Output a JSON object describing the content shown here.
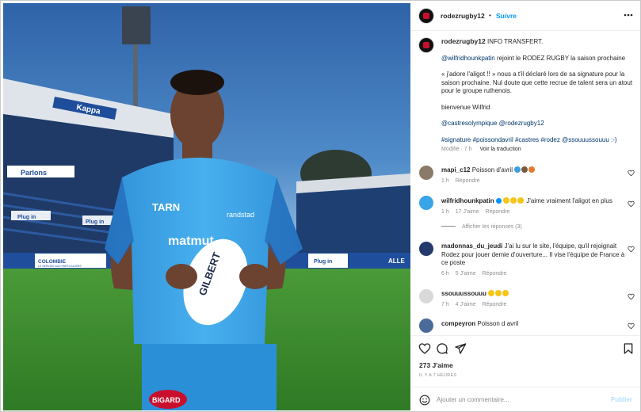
{
  "post": {
    "username": "rodezrugby12",
    "follow_label": "Suivre",
    "dot": "•"
  },
  "photo": {
    "banner_texts": [
      "Kappa",
      "Parlons",
      "Plug in",
      "Plug in",
      "COLOMBIE",
      "LE SERVICE AUX PARTICULIERS",
      "Plug in",
      "randstad",
      "TARN",
      "GILBERT",
      "BIGARD",
      "matmut",
      "ALLE"
    ],
    "colors": {
      "sky": "#3d6fb0",
      "jersey": "#3aa4e8",
      "grass": "#3d8a2f"
    }
  },
  "caption": {
    "author": "rodezrugby12",
    "headline": "INFO TRANSFERT.",
    "mention_player": "@wilfridhounkpatin",
    "line1_rest": " rejoint le RODEZ RUGBY la saison prochaine",
    "quote": "« j'adore l'aligot !! » nous a t'il déclaré lors de sa signature pour la saison prochaine. Nul doute que cette recrue de talent sera un atout pour le groupe ruthenois.",
    "welcome": "bienvenue Wilfrid",
    "mentions": "@castresolympique @rodezrugby12",
    "hashtags": "#signature #poissondavril #castres #rodez @ssouuussouuu :-)",
    "modified": "Modifié · 7 h",
    "translate": "Voir la traduction"
  },
  "comments": [
    {
      "user": "mapi_c12",
      "text": "Poisson d'avril",
      "time": "1 h",
      "likes": "",
      "reply": "Répondre"
    },
    {
      "user": "wilfridhounkpatin",
      "text": "J'aime vraiment l'aligot en plus",
      "time": "1 h",
      "likes": "17 J'aime",
      "reply": "Répondre"
    },
    {
      "user": "madonnas_du_jeudi",
      "text": "J'ai lu sur le site, l'équipe, qu'il rejoignait Rodez pour jouer demie d'ouverture... Il vise l'équipe de France à ce poste",
      "time": "6 h",
      "likes": "5 J'aime",
      "reply": "Répondre"
    },
    {
      "user": "ssouuussouuu",
      "text": "",
      "time": "7 h",
      "likes": "4 J'aime",
      "reply": "Répondre"
    },
    {
      "user": "compeyron",
      "text": "Poisson d avril",
      "time": "",
      "likes": "",
      "reply": ""
    }
  ],
  "replies_toggle": "Afficher les réponses (3)",
  "likes_count": "273 J'aime",
  "time_ago": "IL Y A 7 HEURES",
  "add_comment": {
    "placeholder": "Ajouter un commentaire...",
    "publish": "Publier"
  },
  "icons": [
    "heart-icon",
    "comment-icon",
    "share-icon",
    "bookmark-icon",
    "emoji-icon",
    "verified-icon"
  ]
}
